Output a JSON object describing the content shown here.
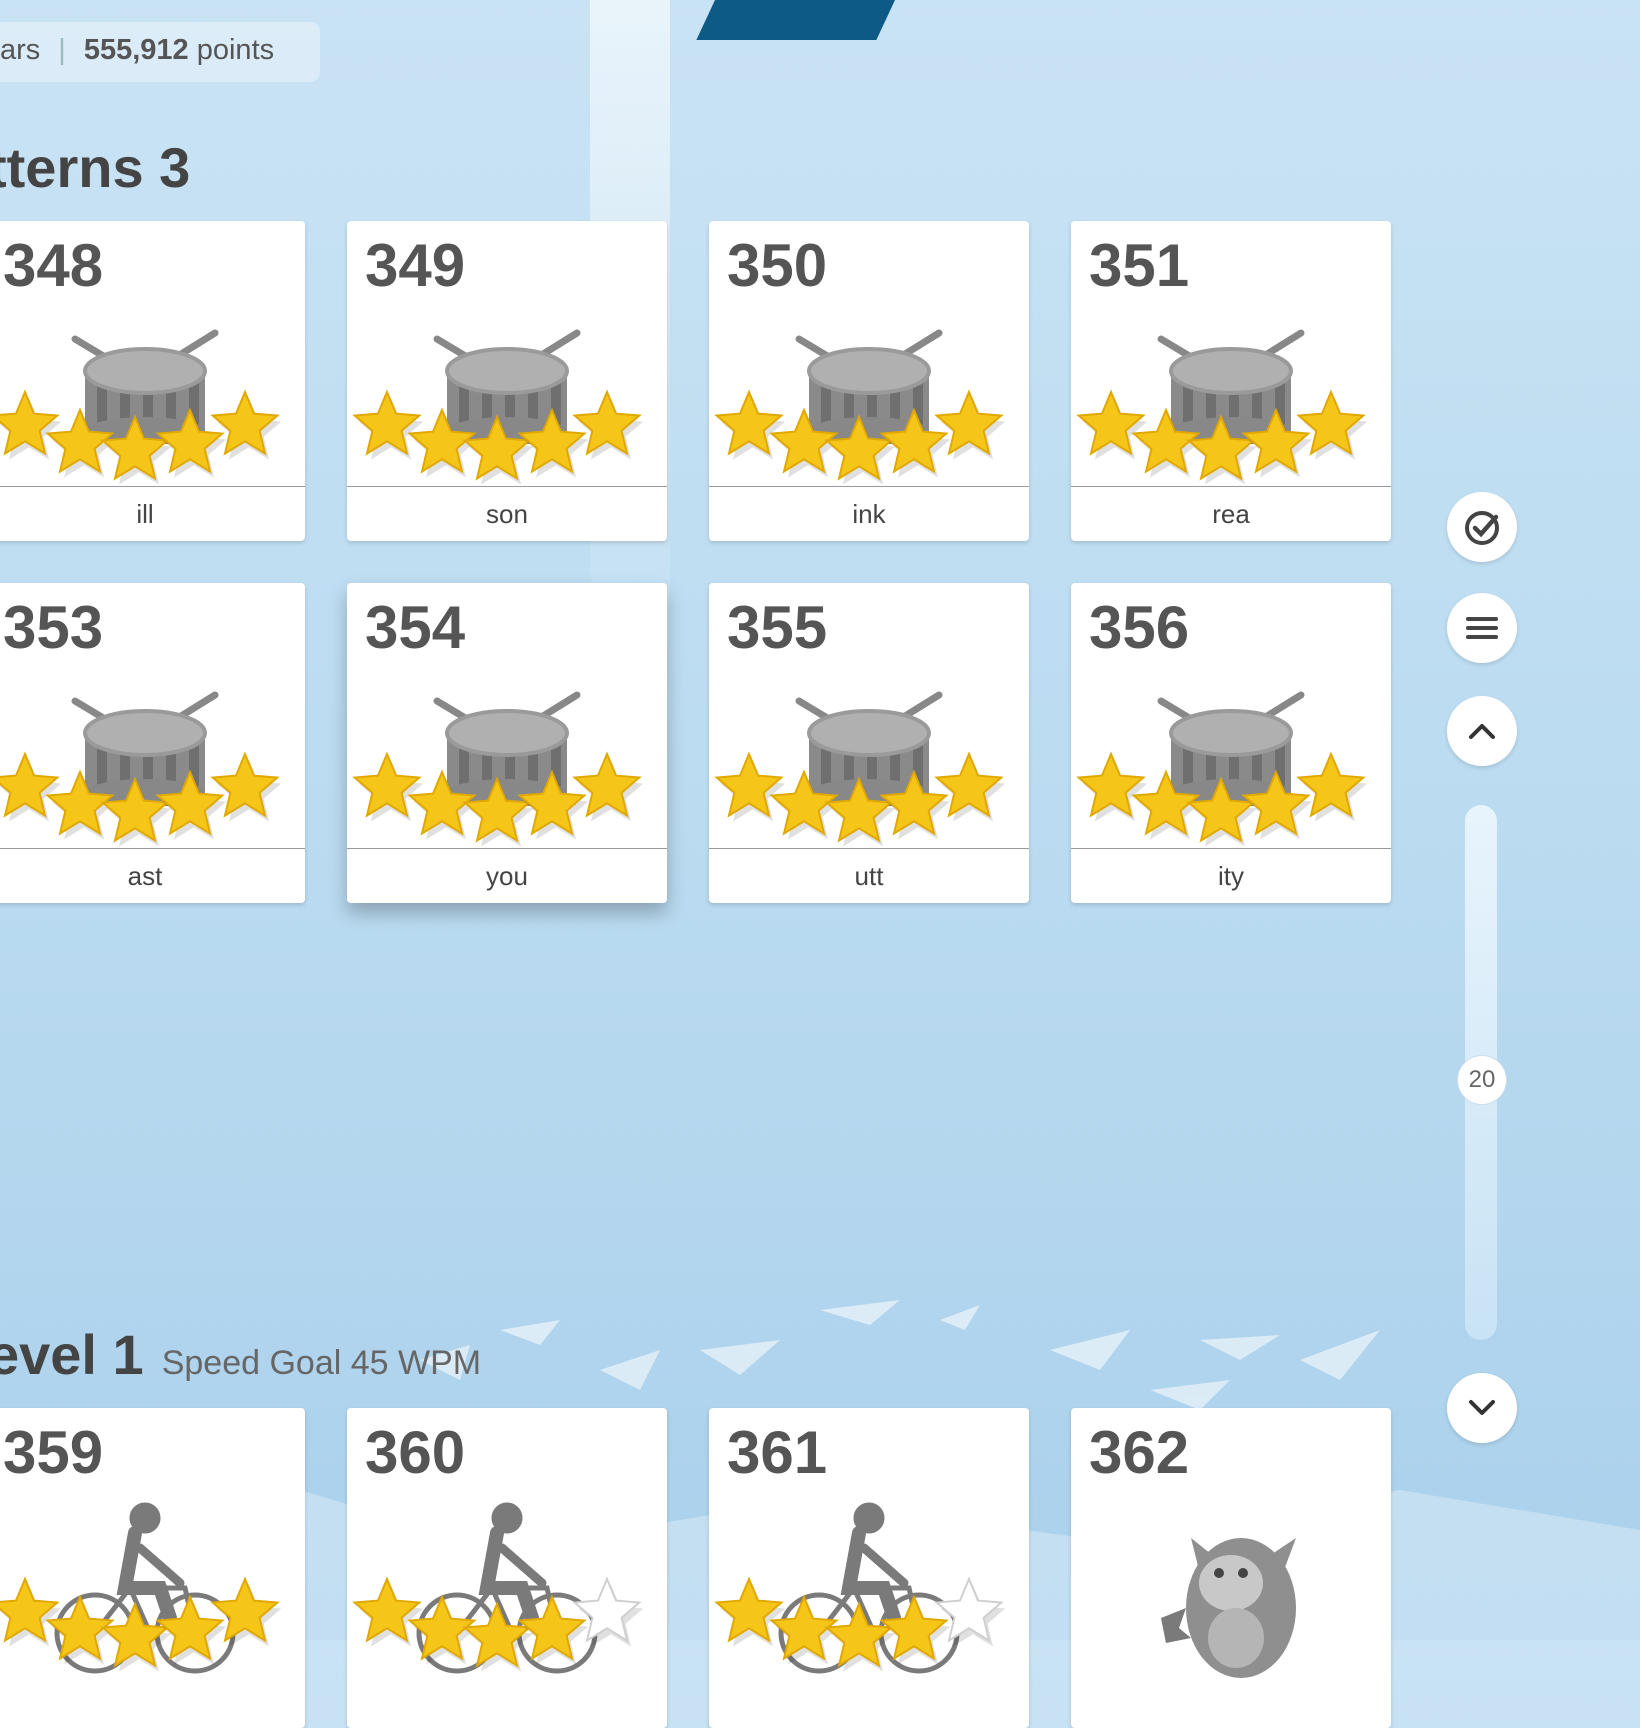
{
  "stats": {
    "stars_fragment": "ars",
    "points_value": "555,912",
    "points_label": "points"
  },
  "section_patterns": {
    "title": "tterns 3"
  },
  "section_speed": {
    "title": "evel 1",
    "goal": "Speed Goal 45 WPM"
  },
  "lessons_row1": [
    {
      "number": "348",
      "word": "ill",
      "stars": 5,
      "icon": "drum-icon"
    },
    {
      "number": "349",
      "word": "son",
      "stars": 5,
      "icon": "drum-icon"
    },
    {
      "number": "350",
      "word": "ink",
      "stars": 5,
      "icon": "drum-icon"
    },
    {
      "number": "351",
      "word": "rea",
      "stars": 5,
      "icon": "drum-icon"
    }
  ],
  "lessons_row2": [
    {
      "number": "353",
      "word": "ast",
      "stars": 5,
      "icon": "drum-icon"
    },
    {
      "number": "354",
      "word": "you",
      "stars": 5,
      "icon": "drum-icon"
    },
    {
      "number": "355",
      "word": "utt",
      "stars": 5,
      "icon": "drum-icon"
    },
    {
      "number": "356",
      "word": "ity",
      "stars": 5,
      "icon": "drum-icon"
    }
  ],
  "lessons_row3": [
    {
      "number": "359",
      "stars": 5,
      "icon": "cyclist-icon"
    },
    {
      "number": "360",
      "stars": 4,
      "icon": "cyclist-icon"
    },
    {
      "number": "361",
      "stars": 4,
      "icon": "cyclist-icon"
    },
    {
      "number": "362",
      "stars": 0,
      "icon": "creature-icon"
    }
  ],
  "scroll": {
    "level_label": "20"
  },
  "colors": {
    "star": "#f5c518",
    "card_text": "#555555",
    "background": "#bcdcf1"
  }
}
